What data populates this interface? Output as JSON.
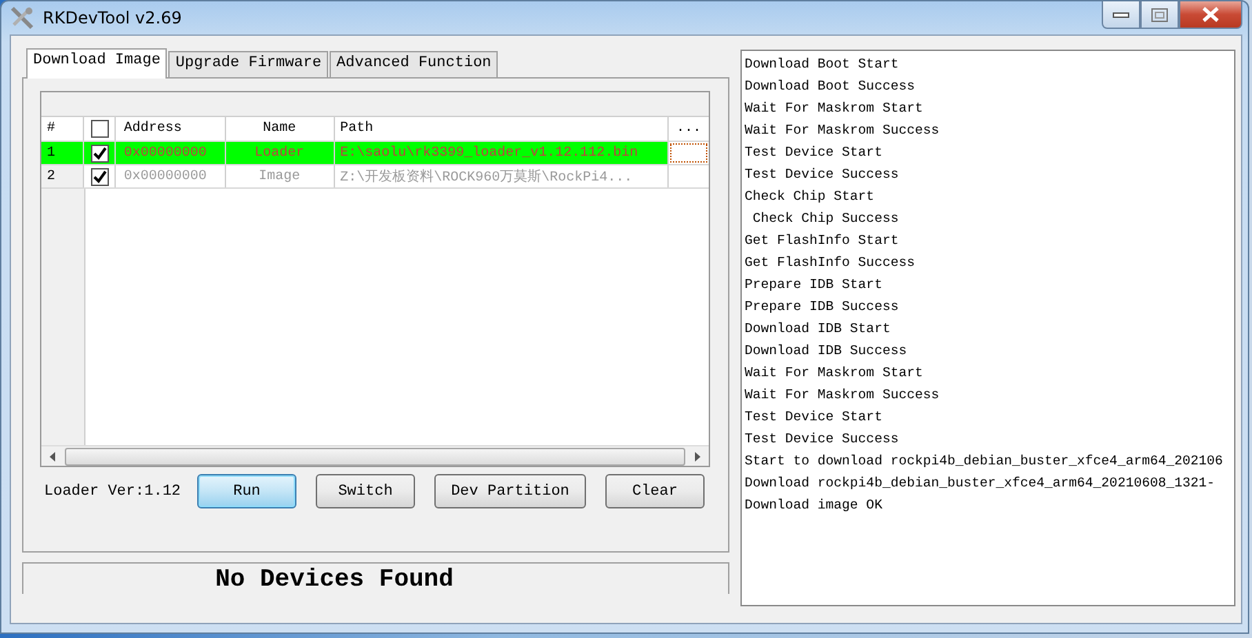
{
  "window": {
    "title": "RKDevTool v2.69"
  },
  "tabs": [
    {
      "label": "Download Image",
      "selected": true
    },
    {
      "label": "Upgrade Firmware",
      "selected": false
    },
    {
      "label": "Advanced Function",
      "selected": false
    }
  ],
  "table": {
    "columns": [
      "#",
      "Address",
      "Name",
      "Path",
      "..."
    ],
    "header_checked": false,
    "rows": [
      {
        "index": "1",
        "checked": true,
        "selected": true,
        "address": "0x00000000",
        "name": "Loader",
        "path": "E:\\saolu\\rk3399_loader_v1.12.112.bin"
      },
      {
        "index": "2",
        "checked": true,
        "selected": false,
        "address": "0x00000000",
        "name": "Image",
        "path": "Z:\\开发板资料\\ROCK960万莫斯\\RockPi4..."
      }
    ]
  },
  "loader_version": "Loader Ver:1.12",
  "buttons": [
    {
      "label": "Run",
      "focused": true
    },
    {
      "label": "Switch",
      "focused": false
    },
    {
      "label": "Dev  Partition",
      "focused": false
    },
    {
      "label": "Clear",
      "focused": false
    }
  ],
  "status_bar": "No Devices Found",
  "log": [
    "Download Boot Start",
    "Download Boot Success",
    "Wait For Maskrom Start",
    "Wait For Maskrom Success",
    "Test Device Start",
    "Test Device Success",
    "Check Chip Start",
    " Check Chip Success",
    "Get FlashInfo Start",
    "Get FlashInfo Success",
    "Prepare IDB Start",
    "Prepare IDB Success",
    "Download IDB Start",
    "Download IDB Success",
    "Wait For Maskrom Start",
    "Wait For Maskrom Success",
    "Test Device Start",
    "Test Device Success",
    "Start to download rockpi4b_debian_buster_xfce4_arm64_202106",
    "Download rockpi4b_debian_buster_xfce4_arm64_20210608_1321-",
    "Download image OK"
  ]
}
